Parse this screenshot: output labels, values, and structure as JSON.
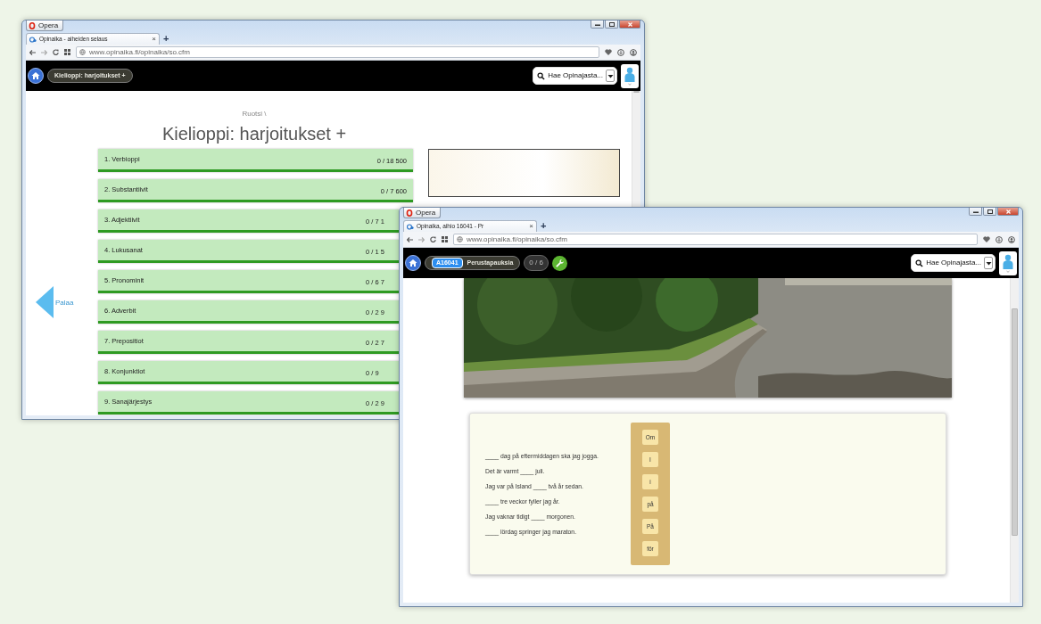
{
  "back_window": {
    "title_button": "Opera",
    "tab_title": "Opinaika - aiheiden selaus",
    "tab_close": "×",
    "new_tab": "+",
    "address": "www.opinaika.fi/opinaika/so.cfm",
    "nav": {
      "topic": "Kielioppi: harjoitukset +",
      "search_label": "Hae Opinajasta..."
    },
    "breadcrumb": "Ruotsi \\",
    "title": "Kielioppi: harjoitukset +",
    "back_link": "Palaa",
    "topics": [
      {
        "label": "1. Verbioppi",
        "count": "0 / 18 500"
      },
      {
        "label": "2. Substantiivit",
        "count": "0 / 7 600"
      },
      {
        "label": "3. Adjektiivit",
        "count": "0 / 7 1"
      },
      {
        "label": "4. Lukusanat",
        "count": "0 / 1 5"
      },
      {
        "label": "5. Pronominit",
        "count": "0 / 6 7"
      },
      {
        "label": "6. Adverbit",
        "count": "0 / 2 9"
      },
      {
        "label": "7. Prepositiot",
        "count": "0 / 2 7"
      },
      {
        "label": "8. Konjunktiot",
        "count": "0 / 9"
      },
      {
        "label": "9. Sanajärjestys",
        "count": "0 / 2 9"
      }
    ]
  },
  "front_window": {
    "title_button": "Opera",
    "tab_title": "Opinaika, aihio 16041 - Pr",
    "tab_close": "×",
    "new_tab": "+",
    "address": "www.opinaika.fi/opinaika/so.cfm",
    "nav": {
      "code": "A16041",
      "topic": "Perustapauksia",
      "progress": "0 / 6",
      "search_label": "Hae Opinajasta..."
    },
    "sentences": [
      "____ dag på eftermiddagen ska jag jogga.",
      "Det är varmt ____ juli.",
      "Jag var på Island ____ två år sedan.",
      "____ tre veckor fyller jag år.",
      "Jag vaknar tidigt ____ morgonen.",
      "____ lördag springer jag maraton."
    ],
    "word_choices": [
      "Om",
      "I",
      "i",
      "på",
      "På",
      "för"
    ]
  }
}
